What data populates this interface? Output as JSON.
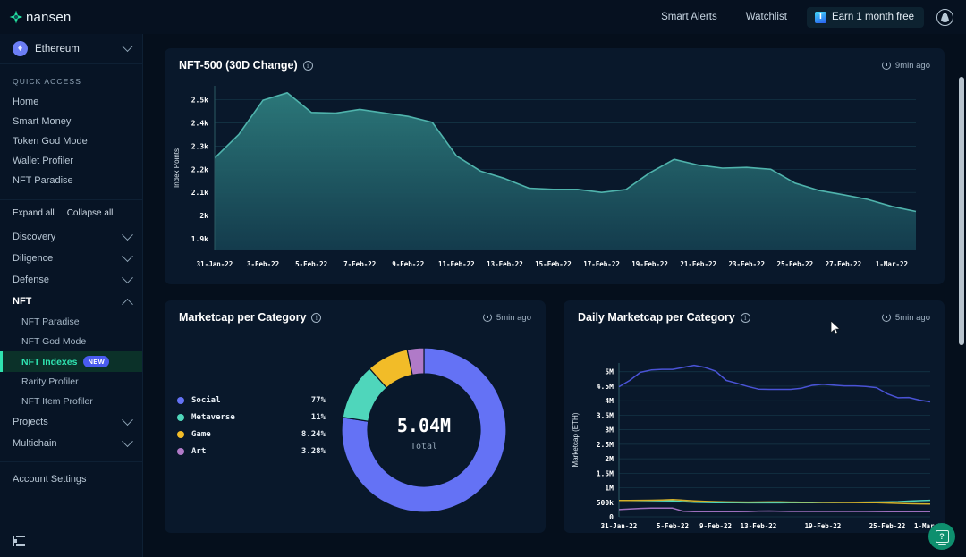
{
  "brand": {
    "name": "nansen",
    "logo_icon": "nansen-star-icon",
    "accent": "#2fe3b0"
  },
  "topbar": {
    "links": [
      {
        "label": "Smart Alerts",
        "name": "smart-alerts"
      },
      {
        "label": "Watchlist",
        "name": "watchlist"
      }
    ],
    "earn": {
      "label": "Earn 1 month free",
      "icon": "tier-t-icon"
    },
    "account_icon": "account-avatar-icon"
  },
  "sidebar": {
    "chain": {
      "label": "Ethereum",
      "icon": "ethereum-icon",
      "chevron": "chevron-down-icon"
    },
    "quick_access_title": "QUICK ACCESS",
    "quick_access": [
      {
        "label": "Home"
      },
      {
        "label": "Smart Money"
      },
      {
        "label": "Token God Mode"
      },
      {
        "label": "Wallet Profiler"
      },
      {
        "label": "NFT Paradise"
      }
    ],
    "expand_all": "Expand all",
    "collapse_all": "Collapse all",
    "groups": [
      {
        "label": "Discovery",
        "open": false,
        "items": []
      },
      {
        "label": "Diligence",
        "open": false,
        "items": []
      },
      {
        "label": "Defense",
        "open": false,
        "items": []
      },
      {
        "label": "NFT",
        "open": true,
        "items": [
          {
            "label": "NFT Paradise",
            "active": false,
            "badge": ""
          },
          {
            "label": "NFT God Mode",
            "active": false,
            "badge": ""
          },
          {
            "label": "NFT Indexes",
            "active": true,
            "badge": "NEW"
          },
          {
            "label": "Rarity Profiler",
            "active": false,
            "badge": ""
          },
          {
            "label": "NFT Item Profiler",
            "active": false,
            "badge": ""
          }
        ]
      },
      {
        "label": "Projects",
        "open": false,
        "items": []
      },
      {
        "label": "Multichain",
        "open": false,
        "items": []
      }
    ],
    "account_settings": "Account Settings",
    "collapse_icon": "collapse-sidebar-icon"
  },
  "cards": {
    "nft500": {
      "title": "NFT-500 (30D Change)",
      "info_icon": "info-icon",
      "stamp": "9min ago",
      "clock_icon": "clock-icon"
    },
    "marketcap_category": {
      "title": "Marketcap per Category",
      "info_icon": "info-icon",
      "stamp": "5min ago",
      "clock_icon": "clock-icon"
    },
    "daily_marketcap": {
      "title": "Daily Marketcap per Category",
      "info_icon": "info-icon",
      "stamp": "5min ago",
      "clock_icon": "clock-icon"
    }
  },
  "help_fab": {
    "name": "help-button",
    "glyph": "?"
  },
  "chart_data": [
    {
      "id": "nft500",
      "type": "area",
      "title": "NFT-500 (30D Change)",
      "xlabel": "",
      "ylabel": "Index Points",
      "ylim": [
        1850,
        2560
      ],
      "yticks": [
        "1.9k",
        "2k",
        "2.1k",
        "2.2k",
        "2.3k",
        "2.4k",
        "2.5k"
      ],
      "ytick_values": [
        1900,
        2000,
        2100,
        2200,
        2300,
        2400,
        2500
      ],
      "grid": true,
      "legend": "none",
      "line_color": "#4fb3ac",
      "fill_top": "#2d7c7d",
      "fill_bottom": "#143d4e",
      "x": [
        "31-Jan-22",
        "1-Feb-22",
        "2-Feb-22",
        "3-Feb-22",
        "4-Feb-22",
        "5-Feb-22",
        "6-Feb-22",
        "7-Feb-22",
        "8-Feb-22",
        "9-Feb-22",
        "10-Feb-22",
        "11-Feb-22",
        "12-Feb-22",
        "13-Feb-22",
        "14-Feb-22",
        "15-Feb-22",
        "16-Feb-22",
        "17-Feb-22",
        "18-Feb-22",
        "19-Feb-22",
        "20-Feb-22",
        "21-Feb-22",
        "22-Feb-22",
        "23-Feb-22",
        "24-Feb-22",
        "25-Feb-22",
        "26-Feb-22",
        "27-Feb-22",
        "28-Feb-22",
        "1-Mar-22"
      ],
      "xticks": [
        "31-Jan-22",
        "3-Feb-22",
        "5-Feb-22",
        "7-Feb-22",
        "9-Feb-22",
        "11-Feb-22",
        "13-Feb-22",
        "15-Feb-22",
        "17-Feb-22",
        "19-Feb-22",
        "21-Feb-22",
        "23-Feb-22",
        "25-Feb-22",
        "27-Feb-22",
        "1-Mar-22"
      ],
      "values": [
        2248,
        2350,
        2498,
        2530,
        2445,
        2442,
        2458,
        2443,
        2428,
        2402,
        2258,
        2192,
        2160,
        2118,
        2113,
        2113,
        2100,
        2112,
        2185,
        2243,
        2218,
        2205,
        2208,
        2200,
        2140,
        2108,
        2090,
        2070,
        2040,
        2018
      ]
    },
    {
      "id": "marketcap_per_category",
      "type": "pie",
      "title": "Marketcap per Category",
      "center_value": "5.04M",
      "center_label": "Total",
      "legend": "left",
      "slices": [
        {
          "label": "Social",
          "display": "77%",
          "value": 77.48,
          "color": "#6472f5"
        },
        {
          "label": "Metaverse",
          "display": "11%",
          "value": 11.0,
          "color": "#4fd6bb"
        },
        {
          "label": "Game",
          "display": "8.24%",
          "value": 8.24,
          "color": "#f2bc28"
        },
        {
          "label": "Art",
          "display": "3.28%",
          "value": 3.28,
          "color": "#b07ac8"
        }
      ]
    },
    {
      "id": "daily_marketcap_per_category",
      "type": "line",
      "title": "Daily Marketcap per Category",
      "xlabel": "",
      "ylabel": "Marketcap (ETH)",
      "ylim": [
        0,
        5300000
      ],
      "yticks": [
        "0",
        "500k",
        "1M",
        "1.5M",
        "2M",
        "2.5M",
        "3M",
        "3.5M",
        "4M",
        "4.5M",
        "5M"
      ],
      "ytick_values": [
        0,
        500000,
        1000000,
        1500000,
        2000000,
        2500000,
        3000000,
        3500000,
        4000000,
        4500000,
        5000000
      ],
      "grid": true,
      "xticks": [
        "31-Jan-22",
        "5-Feb-22",
        "9-Feb-22",
        "13-Feb-22",
        "19-Feb-22",
        "25-Feb-22",
        "1-Mar-22"
      ],
      "x": [
        "31-Jan-22",
        "1-Feb-22",
        "2-Feb-22",
        "3-Feb-22",
        "4-Feb-22",
        "5-Feb-22",
        "6-Feb-22",
        "7-Feb-22",
        "8-Feb-22",
        "9-Feb-22",
        "10-Feb-22",
        "11-Feb-22",
        "12-Feb-22",
        "13-Feb-22",
        "14-Feb-22",
        "15-Feb-22",
        "16-Feb-22",
        "17-Feb-22",
        "18-Feb-22",
        "19-Feb-22",
        "20-Feb-22",
        "21-Feb-22",
        "22-Feb-22",
        "23-Feb-22",
        "24-Feb-22",
        "25-Feb-22",
        "26-Feb-22",
        "27-Feb-22",
        "28-Feb-22",
        "1-Mar-22"
      ],
      "series": [
        {
          "name": "Social",
          "color": "#4a53d6",
          "values": [
            4480000,
            4700000,
            4980000,
            5060000,
            5080000,
            5080000,
            5150000,
            5220000,
            5150000,
            5020000,
            4700000,
            4600000,
            4490000,
            4400000,
            4390000,
            4390000,
            4390000,
            4430000,
            4530000,
            4570000,
            4540000,
            4510000,
            4510000,
            4490000,
            4450000,
            4240000,
            4100000,
            4110000,
            4020000,
            3960000
          ]
        },
        {
          "name": "Metaverse",
          "color": "#4fd6bb",
          "values": [
            560000,
            560000,
            558000,
            555000,
            552000,
            548000,
            520000,
            500000,
            492000,
            488000,
            486000,
            484000,
            482000,
            480000,
            480000,
            482000,
            484000,
            486000,
            488000,
            492000,
            494000,
            496000,
            500000,
            504000,
            508000,
            512000,
            520000,
            540000,
            556000,
            566000
          ]
        },
        {
          "name": "Game",
          "color": "#d4b12a",
          "values": [
            560000,
            562000,
            566000,
            570000,
            580000,
            596000,
            570000,
            548000,
            534000,
            520000,
            512000,
            508000,
            506000,
            508000,
            512000,
            510000,
            506000,
            502000,
            498000,
            496000,
            494000,
            492000,
            490000,
            488000,
            484000,
            476000,
            462000,
            450000,
            444000,
            442000
          ]
        },
        {
          "name": "Art",
          "color": "#9d6fbd",
          "values": [
            250000,
            268000,
            290000,
            300000,
            300000,
            298000,
            190000,
            180000,
            178000,
            176000,
            176000,
            178000,
            182000,
            196000,
            200000,
            192000,
            186000,
            184000,
            184000,
            184000,
            184000,
            184000,
            184000,
            184000,
            182000,
            180000,
            178000,
            178000,
            178000,
            180000
          ]
        }
      ]
    }
  ]
}
